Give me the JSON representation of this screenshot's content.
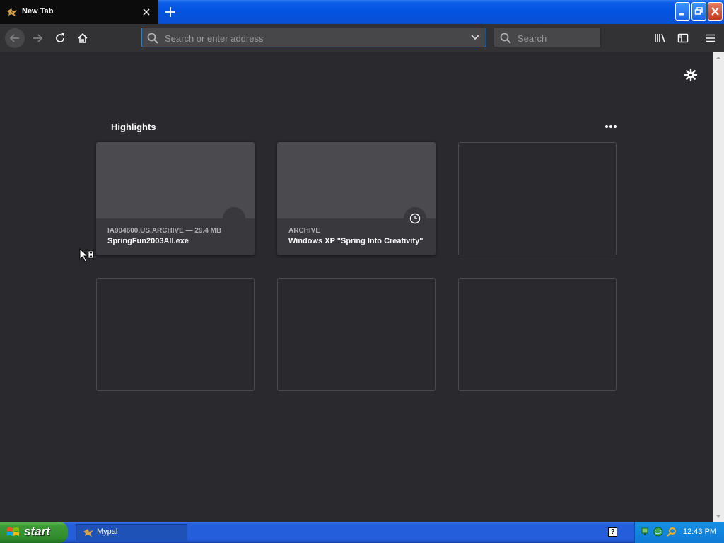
{
  "browser": {
    "tab_title": "New Tab",
    "url_placeholder": "Search or enter address",
    "search_placeholder": "Search"
  },
  "highlights": {
    "title": "Highlights",
    "cards": [
      {
        "context": "IA904600.US.ARCHIVE — 29.4 MB",
        "title": "SpringFun2003All.exe",
        "badge_icon": "download-icon"
      },
      {
        "context": "ARCHIVE",
        "title": "Windows XP \"Spring Into Creativity\"",
        "badge_icon": "clock-icon"
      }
    ]
  },
  "taskbar": {
    "start_label": "start",
    "window_label": "Mypal",
    "help_glyph": "?",
    "clock": "12:43 PM"
  },
  "colors": {
    "accent": "#0a84ff",
    "background": "#2a2a2e",
    "card": "#38383d",
    "toolbar": "#323234"
  }
}
